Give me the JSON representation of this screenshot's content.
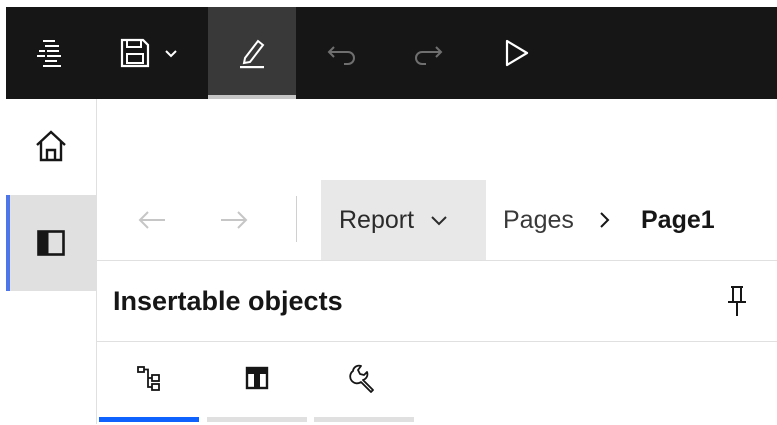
{
  "toolbar": {
    "menu_icon": "app-menu-icon",
    "save_icon": "save-icon",
    "save_dropdown_icon": "chevron-down-icon",
    "edit_icon": "edit-icon",
    "undo_icon": "undo-icon",
    "redo_icon": "redo-icon",
    "run_icon": "run-icon"
  },
  "rail": {
    "home_icon": "home-icon",
    "panel_icon": "panel-icon"
  },
  "breadcrumb": {
    "report_label": "Report",
    "pages_label": "Pages",
    "page_label": "Page1"
  },
  "panel": {
    "title": "Insertable objects",
    "tabs": [
      {
        "icon": "data-tree-icon",
        "active": true
      },
      {
        "icon": "toolbox-icon",
        "active": false
      },
      {
        "icon": "wrench-icon",
        "active": false
      }
    ]
  },
  "colors": {
    "toolbar_bg": "#161616",
    "active_tool_bg": "#393939",
    "rail_selected_bg": "#e0e0e0",
    "rail_accent": "#4e76e8",
    "tab_active": "#0f62fe"
  }
}
